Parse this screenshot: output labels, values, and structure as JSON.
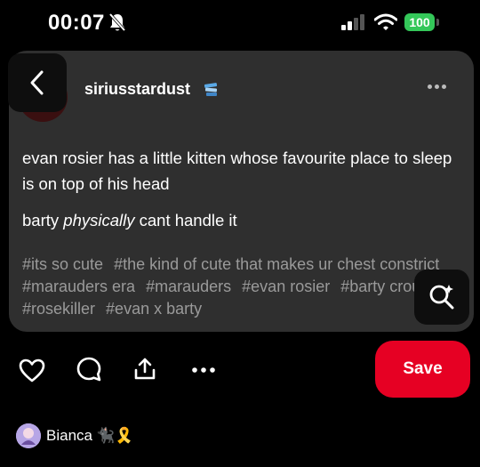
{
  "status_bar": {
    "time": "00:07",
    "battery": "100",
    "icons": [
      "bell-muted-icon",
      "cell-signal-icon",
      "wifi-icon",
      "battery-icon"
    ]
  },
  "post": {
    "username": "siriusstardust",
    "badge_icon": "blue-sticker-icon",
    "paragraph1": "evan rosier has a little kitten whose favourite place to sleep is on top of his head",
    "paragraph2_before": "barty ",
    "paragraph2_emphasis": "physically",
    "paragraph2_after": " cant handle it",
    "tags": [
      "#its so cute",
      "#the kind of cute that makes ur chest constrict",
      "#marauders era",
      "#marauders",
      "#evan rosier",
      "#barty crouch jr",
      "#rosekiller",
      "#evan x barty"
    ]
  },
  "actions": {
    "save_label": "Save",
    "icons": [
      "heart-icon",
      "comment-icon",
      "share-icon",
      "more-icon"
    ]
  },
  "saved_by": {
    "name": "Bianca",
    "emojis": "🐈‍⬛🎗️"
  },
  "colors": {
    "accent": "#e60023",
    "card": "#2f2f2f",
    "tag_text": "#9a9a9a",
    "battery": "#34c759"
  }
}
